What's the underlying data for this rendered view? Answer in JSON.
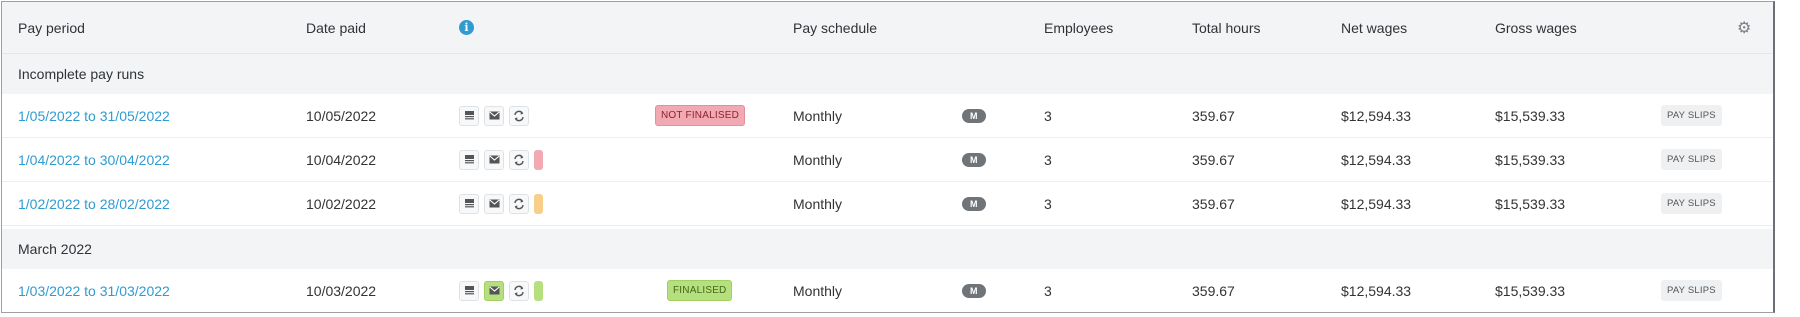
{
  "colors": {
    "link": "#2f9bd1",
    "not_finalised": "#f2a9b2",
    "finalised": "#b6e07f",
    "flag_red": "#f2a9b2",
    "flag_orange": "#f8cf8a",
    "flag_green": "#b6e07f",
    "pill": "#6f7479"
  },
  "header": {
    "pay_period": "Pay period",
    "date_paid": "Date paid",
    "info_icon": "i",
    "pay_schedule": "Pay schedule",
    "employees": "Employees",
    "total_hours": "Total hours",
    "net_wages": "Net wages",
    "gross_wages": "Gross wages",
    "settings_icon": "gear-icon"
  },
  "groups": [
    {
      "label": "Incomplete pay runs",
      "rows": [
        {
          "period": "1/05/2022 to 31/05/2022",
          "date_paid": "10/05/2022",
          "email_sent": false,
          "flag": "none",
          "status": "NOT FINALISED",
          "schedule": "Monthly",
          "schedule_badge": "M",
          "employees": "3",
          "total_hours": "359.67",
          "net_wages": "$12,594.33",
          "gross_wages": "$15,539.33",
          "action": "PAY SLIPS"
        },
        {
          "period": "1/04/2022 to 30/04/2022",
          "date_paid": "10/04/2022",
          "email_sent": false,
          "flag": "red",
          "status": "",
          "schedule": "Monthly",
          "schedule_badge": "M",
          "employees": "3",
          "total_hours": "359.67",
          "net_wages": "$12,594.33",
          "gross_wages": "$15,539.33",
          "action": "PAY SLIPS"
        },
        {
          "period": "1/02/2022 to 28/02/2022",
          "date_paid": "10/02/2022",
          "email_sent": false,
          "flag": "orange",
          "status": "",
          "schedule": "Monthly",
          "schedule_badge": "M",
          "employees": "3",
          "total_hours": "359.67",
          "net_wages": "$12,594.33",
          "gross_wages": "$15,539.33",
          "action": "PAY SLIPS"
        }
      ]
    },
    {
      "label": "March 2022",
      "rows": [
        {
          "period": "1/03/2022 to 31/03/2022",
          "date_paid": "10/03/2022",
          "email_sent": true,
          "flag": "green",
          "status": "FINALISED",
          "schedule": "Monthly",
          "schedule_badge": "M",
          "employees": "3",
          "total_hours": "359.67",
          "net_wages": "$12,594.33",
          "gross_wages": "$15,539.33",
          "action": "PAY SLIPS"
        }
      ]
    }
  ]
}
